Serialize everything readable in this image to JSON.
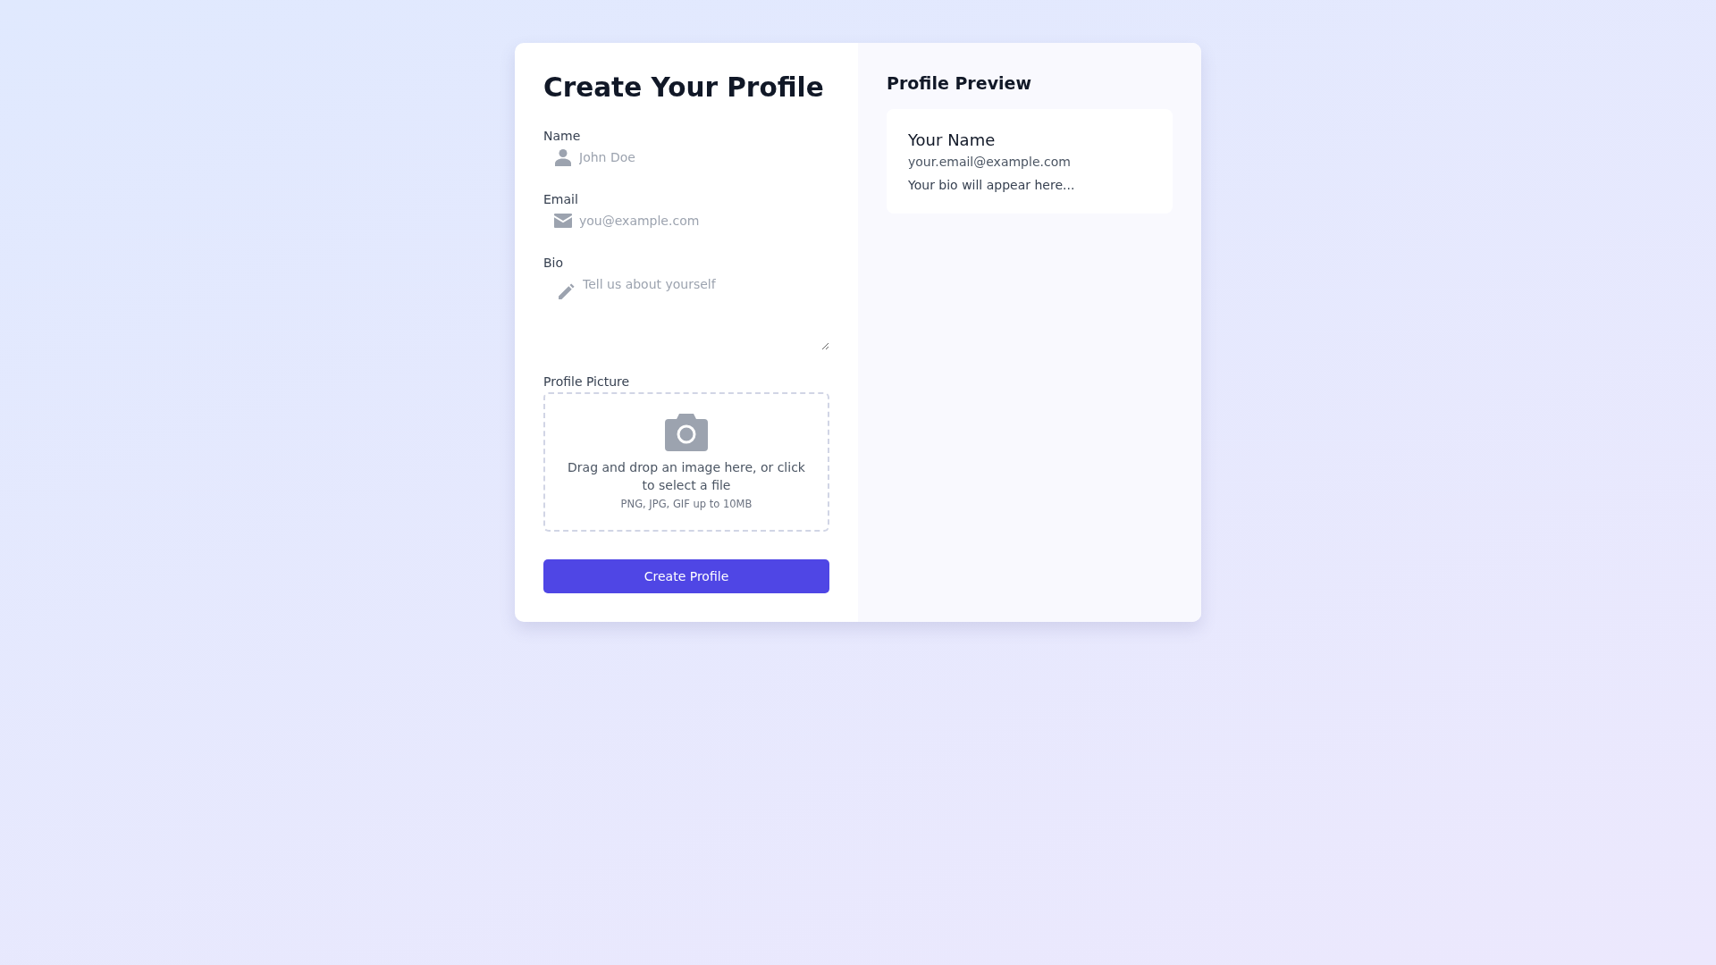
{
  "form": {
    "title": "Create Your Profile",
    "fields": [
      {
        "kind": "text",
        "label": "Name",
        "placeholder": "John Doe"
      },
      {
        "kind": "email",
        "label": "Email",
        "placeholder": "you@example.com"
      },
      {
        "kind": "textarea",
        "label": "Bio",
        "placeholder": "Tell us about yourself"
      }
    ],
    "upload": {
      "label": "Profile Picture",
      "instruction": "Drag and drop an image here, or click to select a file",
      "hint": "PNG, JPG, GIF up to 10MB"
    },
    "submit": "Create Profile"
  },
  "preview": {
    "title": "Profile Preview",
    "name": "Your Name",
    "email": "your.email@example.com",
    "bio": "Your bio will appear here..."
  }
}
